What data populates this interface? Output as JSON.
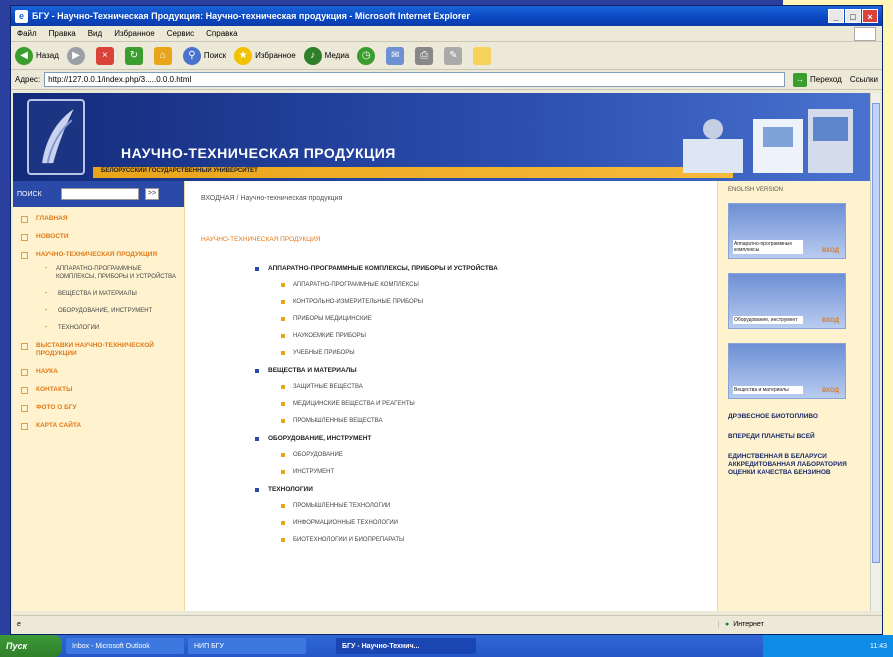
{
  "window": {
    "title": "БГУ - Научно-Техническая Продукция: Научно-техническая продукция - Microsoft Internet Explorer",
    "buttons": [
      "_",
      "□",
      "×"
    ]
  },
  "menubar": [
    "Файл",
    "Правка",
    "Вид",
    "Избранное",
    "Сервис",
    "Справка"
  ],
  "toolbar": {
    "back": "Назад",
    "search": "Поиск",
    "favorites": "Избранное",
    "media": "Медиа"
  },
  "address": {
    "label": "Адрес:",
    "url": "http://127.0.0.1/index.php/3.....0.0.0.html",
    "go": "Переход",
    "links": "Ссылки"
  },
  "banner": {
    "title": "НАУЧНО-ТЕХНИЧЕСКАЯ ПРОДУКЦИЯ",
    "subtitle": "БЕЛОРУССКИЙ ГОСУДАРСТВЕННЫЙ УНИВЕРСИТЕТ"
  },
  "search": {
    "label": "ПОИСК",
    "button": ">>"
  },
  "nav": [
    {
      "label": "ГЛАВНАЯ"
    },
    {
      "label": "НОВОСТИ"
    },
    {
      "label": "НАУЧНО-ТЕХНИЧЕСКАЯ ПРОДУКЦИЯ"
    },
    {
      "label": "ВЫСТАВКИ НАУЧНО-ТЕХНИЧЕСКОЙ ПРОДУКЦИИ"
    },
    {
      "label": "НАУКА"
    },
    {
      "label": "КОНТАКТЫ"
    },
    {
      "label": "ФОТО О БГУ"
    },
    {
      "label": "КАРТА САЙТА"
    }
  ],
  "subnav": [
    "АППАРАТНО-ПРОГРАММНЫЕ КОМПЛЕКСЫ, ПРИБОРЫ И УСТРОЙСТВА",
    "ВЕЩЕСТВА И МАТЕРИАЛЫ",
    "ОБОРУДОВАНИЕ, ИНСТРУМЕНТ",
    "ТЕХНОЛОГИИ"
  ],
  "main": {
    "breadcrumb": "ВХОДНАЯ / Научно-техническая продукция",
    "section_title": "НАУЧНО-ТЕХНИЧЕСКАЯ ПРОДУКЦИЯ",
    "categories": [
      {
        "title": "АППАРАТНО-ПРОГРАММНЫЕ КОМПЛЕКСЫ, ПРИБОРЫ И УСТРОЙСТВА",
        "items": [
          "АППАРАТНО-ПРОГРАММНЫЕ КОМПЛЕКСЫ",
          "КОНТРОЛЬНО-ИЗМЕРИТЕЛЬНЫЕ ПРИБОРЫ",
          "ПРИБОРЫ МЕДИЦИНСКИЕ",
          "НАУКОЕМКИЕ ПРИБОРЫ",
          "УЧЕБНЫЕ ПРИБОРЫ"
        ]
      },
      {
        "title": "ВЕЩЕСТВА И МАТЕРИАЛЫ",
        "items": [
          "ЗАЩИТНЫЕ ВЕЩЕСТВА",
          "МЕДИЦИНСКИЕ ВЕЩЕСТВА И РЕАГЕНТЫ",
          "ПРОМЫШЛЕННЫЕ ВЕЩЕСТВА"
        ]
      },
      {
        "title": "ОБОРУДОВАНИЕ, ИНСТРУМЕНТ",
        "items": [
          "ОБОРУДОВАНИЕ",
          "ИНСТРУМЕНТ"
        ]
      },
      {
        "title": "ТЕХНОЛОГИИ",
        "items": [
          "ПРОМЫШЛЕННЫЕ ТЕХНОЛОГИИ",
          "ИНФОРМАЦИОННЫЕ ТЕХНОЛОГИИ",
          "БИОТЕХНОЛОГИИ И БИОПРЕПАРАТЫ"
        ]
      }
    ]
  },
  "right": {
    "english": "ENGLISH VERSION",
    "promos": [
      {
        "caption": "Аппаратно-программные комплексы",
        "go": "ВХОД"
      },
      {
        "caption": "Оборудование, инструмент",
        "go": "ВХОД"
      },
      {
        "caption": "Вещества и материалы",
        "go": "ВХОД"
      }
    ],
    "links": [
      "ДРЭВЕСНОЕ БИОТОПЛИВО",
      "ВПЕРЕДИ ПЛАНЕТЫ ВСЕЙ",
      "ЕДИНСТВЕННАЯ В БЕЛАРУСИ АККРЕДИТОВАННАЯ ЛАБОРАТОРИЯ ОЦЕНКИ КАЧЕСТВА БЕНЗИНОВ"
    ]
  },
  "status": {
    "zone": "Интернет"
  },
  "taskbar": {
    "start": "Пуск",
    "tasks": [
      "Inbox - Microsoft Outlook",
      "НИП БГУ",
      "БГУ - Научно-Технич..."
    ],
    "time": "11:43"
  }
}
